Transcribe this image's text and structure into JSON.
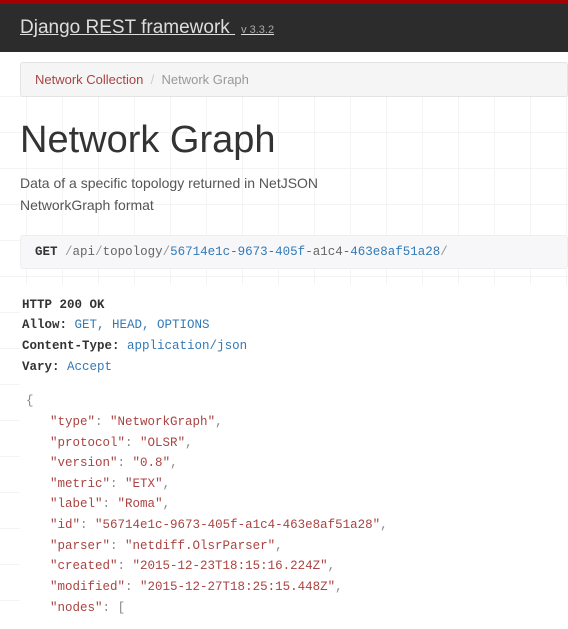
{
  "header": {
    "brand": "Django REST framework",
    "version": "v 3.3.2"
  },
  "breadcrumb": {
    "parent": "Network Collection",
    "sep": "/",
    "current": "Network Graph"
  },
  "page": {
    "title": "Network Graph",
    "description": "Data of a specific topology returned in NetJSON NetworkGraph format"
  },
  "request": {
    "method": "GET",
    "path_prefix": "/api/topology/",
    "uuid_parts": [
      "56714e1c",
      "9673",
      "405f",
      "a1c4",
      "463e8af51a28"
    ],
    "trail": "/"
  },
  "response": {
    "status": "HTTP 200 OK",
    "headers": {
      "allow_label": "Allow:",
      "allow_value": "GET, HEAD, OPTIONS",
      "ctype_label": "Content-Type:",
      "ctype_value": "application/json",
      "vary_label": "Vary:",
      "vary_value": "Accept"
    },
    "json": {
      "type": "NetworkGraph",
      "protocol": "OLSR",
      "version": "0.8",
      "metric": "ETX",
      "label": "Roma",
      "id": "56714e1c-9673-405f-a1c4-463e8af51a28",
      "parser": "netdiff.OlsrParser",
      "created": "2015-12-23T18:15:16.224Z",
      "modified": "2015-12-27T18:25:15.448Z",
      "nodes_key": "nodes"
    }
  }
}
